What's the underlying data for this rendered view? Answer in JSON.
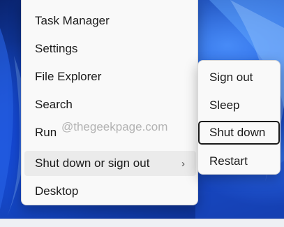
{
  "menu": {
    "items": [
      {
        "label": "Task Manager"
      },
      {
        "label": "Settings"
      },
      {
        "label": "File Explorer"
      },
      {
        "label": "Search"
      },
      {
        "label": "Run"
      },
      {
        "label": "Shut down or sign out",
        "has_submenu": true
      },
      {
        "label": "Desktop"
      }
    ],
    "chevron": "›",
    "hovered_item": "Shut down or sign out"
  },
  "submenu": {
    "items": [
      {
        "label": "Sign out"
      },
      {
        "label": "Sleep"
      },
      {
        "label": "Shut down"
      },
      {
        "label": "Restart"
      }
    ],
    "focused_item": "Shut down"
  },
  "watermark": "@thegeekpage.com",
  "colors": {
    "menu_background": "#f9f9f9",
    "hover_background": "#ebebeb",
    "focus_border": "#1b1b1b",
    "text": "#1b1b1b"
  }
}
